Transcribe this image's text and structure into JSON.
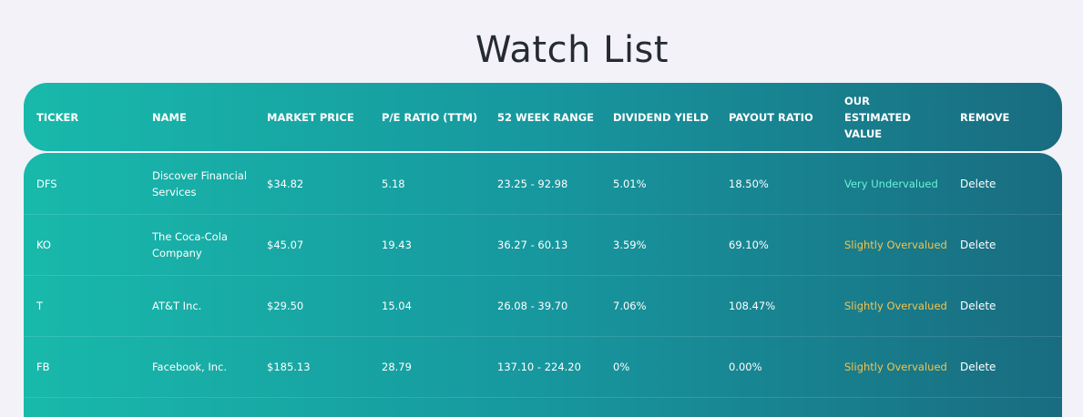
{
  "page_title": "Watch List",
  "headers": {
    "ticker": "TICKER",
    "name": "NAME",
    "market_price": "MARKET PRICE",
    "pe_ratio": "P/E RATIO (TTM)",
    "week_range": "52 WEEK RANGE",
    "dividend_yield": "DIVIDEND YIELD",
    "payout_ratio": "PAYOUT RATIO",
    "estimated_value": "OUR ESTIMATED VALUE",
    "remove": "REMOVE"
  },
  "rows": [
    {
      "ticker": "DFS",
      "name": "Discover Financial Services",
      "price": "$34.82",
      "pe": "5.18",
      "range": "23.25 - 92.98",
      "yield": "5.01%",
      "payout": "18.50%",
      "estimate": "Very Undervalued",
      "estimate_color": "#6bf3d8",
      "action": "Delete"
    },
    {
      "ticker": "KO",
      "name": "The Coca-Cola Company",
      "price": "$45.07",
      "pe": "19.43",
      "range": "36.27 - 60.13",
      "yield": "3.59%",
      "payout": "69.10%",
      "estimate": "Slightly Overvalued",
      "estimate_color": "#f4c34d",
      "action": "Delete"
    },
    {
      "ticker": "T",
      "name": "AT&T Inc.",
      "price": "$29.50",
      "pe": "15.04",
      "range": "26.08 - 39.70",
      "yield": "7.06%",
      "payout": "108.47%",
      "estimate": "Slightly Overvalued",
      "estimate_color": "#f4c34d",
      "action": "Delete"
    },
    {
      "ticker": "FB",
      "name": "Facebook, Inc.",
      "price": "$185.13",
      "pe": "28.79",
      "range": "137.10 - 224.20",
      "yield": "0%",
      "payout": "0.00%",
      "estimate": "Slightly Overvalued",
      "estimate_color": "#f4c34d",
      "action": "Delete"
    }
  ],
  "colors": {
    "background": "#f2f2f8",
    "gradient_start": "#18b9ab",
    "gradient_end": "#196c80",
    "undervalued": "#6bf3d8",
    "overvalued": "#f4c34d"
  }
}
